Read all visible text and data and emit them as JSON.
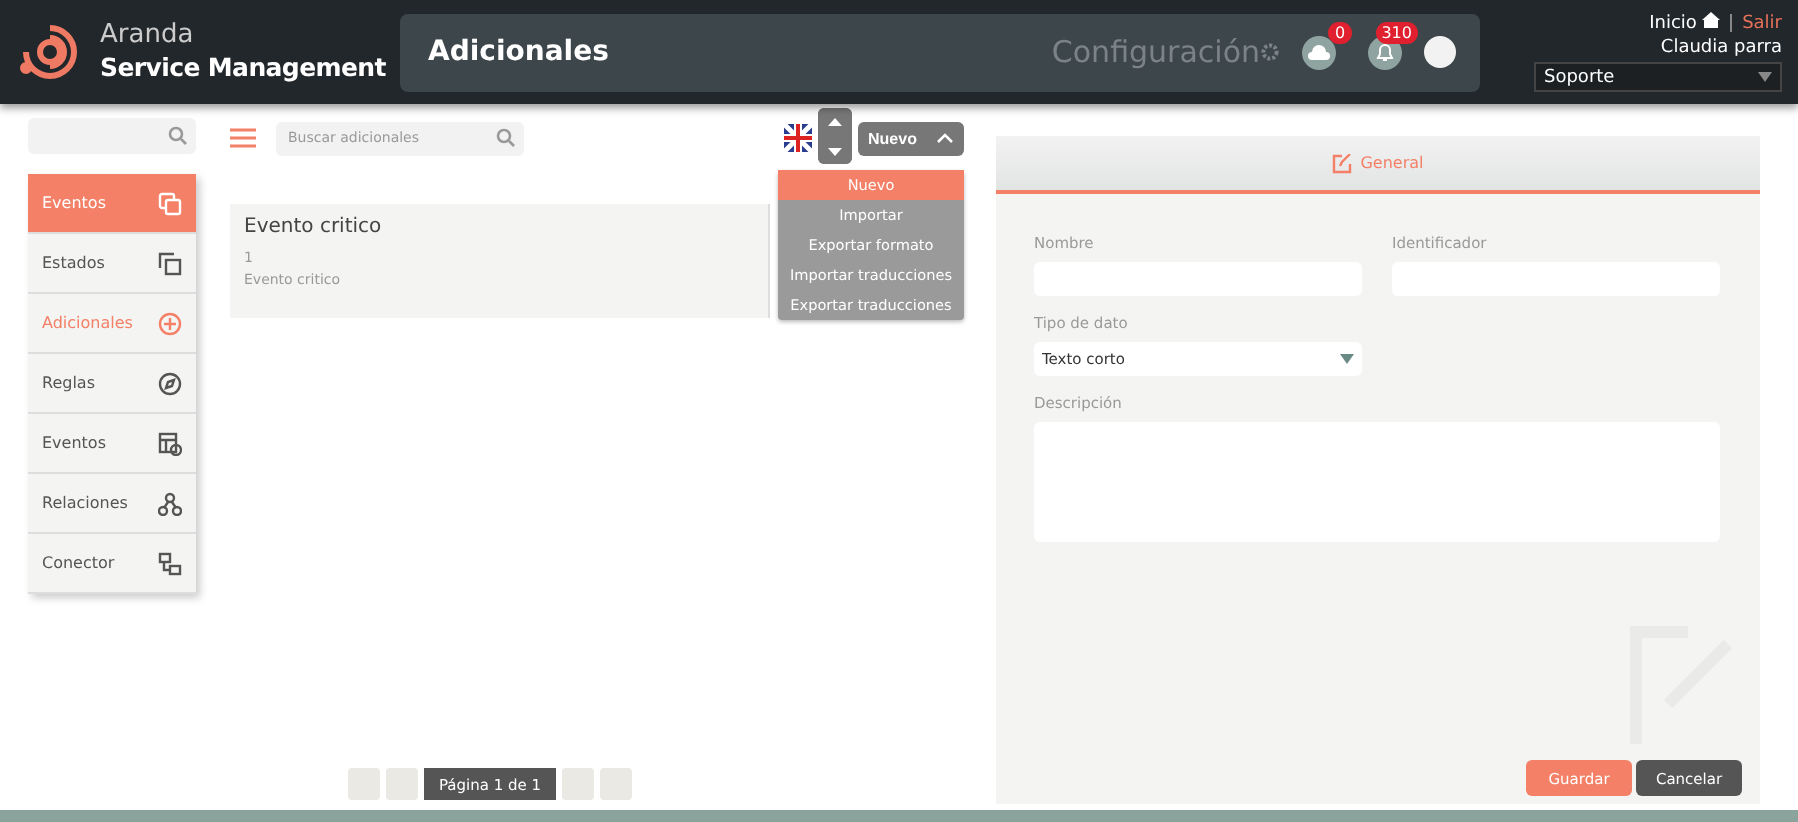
{
  "header": {
    "logo_top": "Aranda",
    "logo_bottom": "Service Management",
    "title": "Adicionales",
    "module": "Configuración",
    "badges": [
      {
        "count": "0"
      },
      {
        "count": "310"
      }
    ],
    "home_link": "Inicio",
    "logout_link": "Salir",
    "user": "Claudia parra",
    "profile": "Soporte"
  },
  "sidebar": {
    "items": [
      {
        "label": "Eventos",
        "selected": true,
        "active": false
      },
      {
        "label": "Estados",
        "selected": false,
        "active": false
      },
      {
        "label": "Adicionales",
        "selected": false,
        "active": true
      },
      {
        "label": "Reglas",
        "selected": false,
        "active": false
      },
      {
        "label": "Eventos",
        "selected": false,
        "active": false
      },
      {
        "label": "Relaciones",
        "selected": false,
        "active": false
      },
      {
        "label": "Conector",
        "selected": false,
        "active": false
      }
    ]
  },
  "list": {
    "search_placeholder": "Buscar adicionales",
    "new_button": "Nuevo",
    "menu": [
      {
        "label": "Nuevo",
        "selected": true
      },
      {
        "label": "Importar",
        "selected": false
      },
      {
        "label": "Exportar formato",
        "selected": false
      },
      {
        "label": "Importar traducciones",
        "selected": false
      },
      {
        "label": "Exportar traducciones",
        "selected": false
      }
    ],
    "cards": [
      {
        "title": "Evento critico",
        "id": "1",
        "description": "Evento critico"
      }
    ],
    "pager": "Página 1 de 1"
  },
  "form": {
    "tab": "General",
    "fields": [
      {
        "kind": "text",
        "label": "Nombre"
      },
      {
        "kind": "text",
        "label": "Identificador"
      },
      {
        "kind": "select",
        "label": "Tipo de dato",
        "value": "Texto corto"
      },
      {
        "kind": "textarea",
        "label": "Descripción"
      }
    ],
    "buttons": [
      {
        "kind": "primary",
        "label": "Guardar"
      },
      {
        "kind": "secondary",
        "label": "Cancelar"
      }
    ]
  }
}
